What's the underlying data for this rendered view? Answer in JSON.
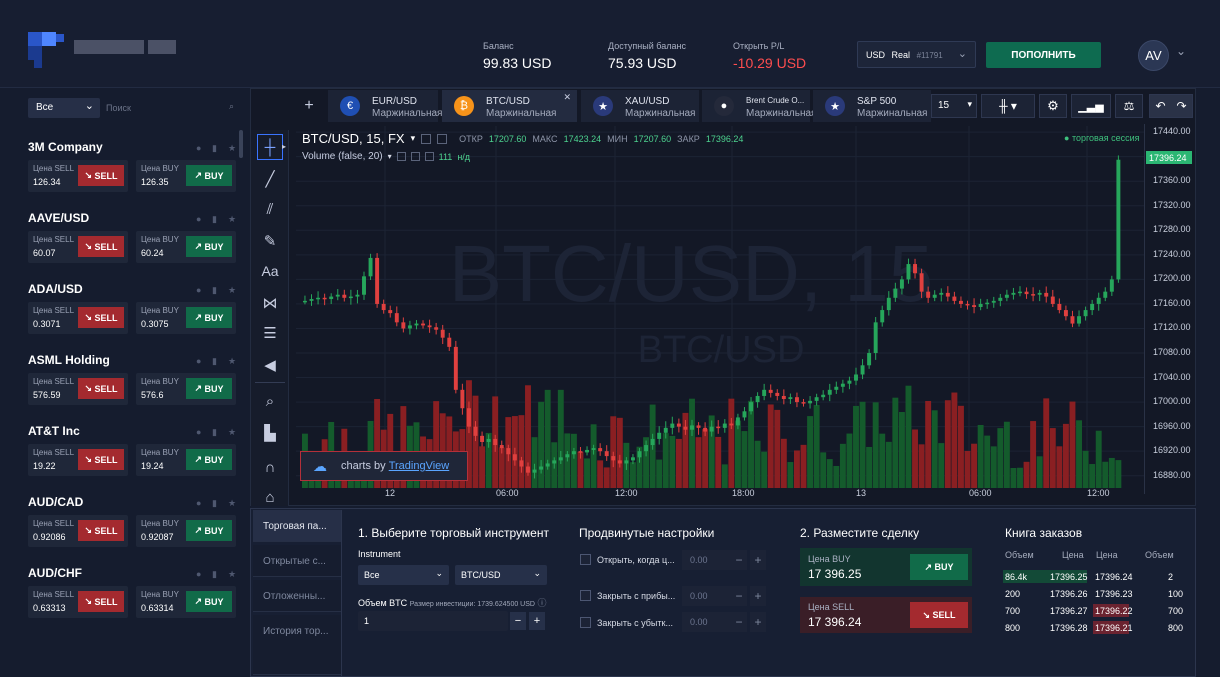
{
  "header": {
    "balance_label": "Баланс",
    "balance_value": "99.83 USD",
    "available_label": "Доступный баланс",
    "available_value": "75.93 USD",
    "pl_label": "Открыть P/L",
    "pl_value": "-10.29 USD",
    "account_currency": "USD",
    "account_type": "Real",
    "account_id": "#11791",
    "topup_label": "ПОПОЛНИТЬ",
    "avatar_initials": "AV"
  },
  "sidebar": {
    "filter_value": "Все",
    "search_placeholder": "Поиск",
    "sell_label_text": "Цена SELL",
    "buy_label_text": "Цена BUY",
    "sell_btn": "SELL",
    "buy_btn": "BUY",
    "instruments": [
      {
        "name": "3M Company",
        "sell": "126.34",
        "buy": "126.35"
      },
      {
        "name": "AAVE/USD",
        "sell": "60.07",
        "buy": "60.24"
      },
      {
        "name": "ADA/USD",
        "sell": "0.3071",
        "buy": "0.3075"
      },
      {
        "name": "ASML Holding",
        "sell": "576.59",
        "buy": "576.6"
      },
      {
        "name": "AT&T Inc",
        "sell": "19.22",
        "buy": "19.24"
      },
      {
        "name": "AUD/CAD",
        "sell": "0.92086",
        "buy": "0.92087"
      },
      {
        "name": "AUD/CHF",
        "sell": "0.63313",
        "buy": "0.63314"
      }
    ]
  },
  "tabs": [
    {
      "sym": "EUR/USD",
      "sub": "Маржинальная",
      "active": false
    },
    {
      "sym": "BTC/USD",
      "sub": "Маржинальная",
      "active": true
    },
    {
      "sym": "XAU/USD",
      "sub": "Маржинальная",
      "active": false
    },
    {
      "sym": "Brent Crude O...",
      "sub": "Маржинальная",
      "active": false
    },
    {
      "sym": "S&P 500",
      "sub": "Маржинальная",
      "active": false
    }
  ],
  "chart_toolbar": {
    "interval": "15"
  },
  "chart": {
    "title": "BTC/USD, 15, FX",
    "ohlc": {
      "o_label": "ОТКР",
      "o": "17207.60",
      "h_label": "МАКС",
      "h": "17423.24",
      "l_label": "МИН",
      "l": "17207.60",
      "c_label": "ЗАКР",
      "c": "17396.24"
    },
    "volume_label": "Volume (false, 20)",
    "volume_value": "111",
    "volume_na": "н/д",
    "session_label": "торговая сессия",
    "watermark_main": "BTC/USD, 15",
    "watermark_sub": "BTC/USD",
    "tv_badge": "charts by",
    "tv_brand": "TradingView",
    "current_price": "17396.24"
  },
  "chart_data": {
    "type": "line",
    "title": "BTC/USD, 15, FX",
    "x_ticks": [
      "12",
      "06:00",
      "12:00",
      "18:00",
      "13",
      "06:00",
      "12:00"
    ],
    "y_ticks": [
      "17440.00",
      "17400.00",
      "17360.00",
      "17320.00",
      "17280.00",
      "17240.00",
      "17200.00",
      "17160.00",
      "17120.00",
      "17080.00",
      "17040.00",
      "17000.00",
      "16960.00",
      "16920.00",
      "16880.00"
    ],
    "ylim": [
      16860,
      17450
    ],
    "series": [
      {
        "name": "BTC/USD",
        "values": [
          17165,
          17168,
          17170,
          17168,
          17172,
          17175,
          17170,
          17172,
          17175,
          17205,
          17235,
          17160,
          17150,
          17145,
          17130,
          17120,
          17125,
          17128,
          17125,
          17122,
          17118,
          17105,
          17090,
          17020,
          16990,
          16960,
          16945,
          16935,
          16940,
          16930,
          16925,
          16915,
          16905,
          16895,
          16885,
          16890,
          16895,
          16900,
          16905,
          16910,
          16915,
          16920,
          16918,
          16922,
          16925,
          16920,
          16912,
          16905,
          16900,
          16905,
          16910,
          16920,
          16930,
          16940,
          16950,
          16958,
          16965,
          16960,
          16955,
          16962,
          16958,
          16952,
          16960,
          16958,
          16965,
          16962,
          16975,
          16985,
          17000,
          17010,
          17020,
          17015,
          17010,
          17005,
          17008,
          17000,
          16998,
          17002,
          17008,
          17012,
          17020,
          17025,
          17030,
          17035,
          17045,
          17060,
          17080,
          17130,
          17150,
          17170,
          17185,
          17200,
          17225,
          17210,
          17180,
          17170,
          17175,
          17178,
          17172,
          17165,
          17160,
          17158,
          17155,
          17160,
          17162,
          17165,
          17170,
          17175,
          17178,
          17180,
          17176,
          17175,
          17178,
          17172,
          17160,
          17150,
          17140,
          17128,
          17140,
          17150,
          17160,
          17170,
          17180,
          17200,
          17395
        ]
      }
    ]
  },
  "bottom": {
    "tabs": [
      "Торговая па...",
      "Открытые с...",
      "Отложенны...",
      "История тор..."
    ],
    "step1_title": "1. Выберите торговый инструмент",
    "instrument_label": "Instrument",
    "category_value": "Все",
    "instrument_value": "BTC/USD",
    "volume_label": "Объем BTC",
    "volume_hint": "Размер инвестиции: 1739.624500 USD",
    "volume_value": "1",
    "adv_title": "Продвинутые настройки",
    "opt_open": "Открыть, когда ц...",
    "opt_tp": "Закрыть с прибы...",
    "opt_sl": "Закрыть с убытк...",
    "opt_placeholder": "0.00",
    "step2_title": "2. Разместите сделку",
    "buy_price_label": "Цена BUY",
    "buy_price": "17 396.25",
    "sell_price_label": "Цена SELL",
    "sell_price": "17 396.24",
    "buy_btn": "BUY",
    "sell_btn": "SELL",
    "orderbook_title": "Книга заказов",
    "ob_headers": [
      "Объем",
      "Цена",
      "Цена",
      "Объем"
    ],
    "ob_rows": [
      [
        "86.4k",
        "17396.25",
        "17396.24",
        "2"
      ],
      [
        "200",
        "17396.26",
        "17396.23",
        "100"
      ],
      [
        "700",
        "17396.27",
        "17396.22",
        "700"
      ],
      [
        "800",
        "17396.28",
        "17396.21",
        "800"
      ]
    ]
  }
}
